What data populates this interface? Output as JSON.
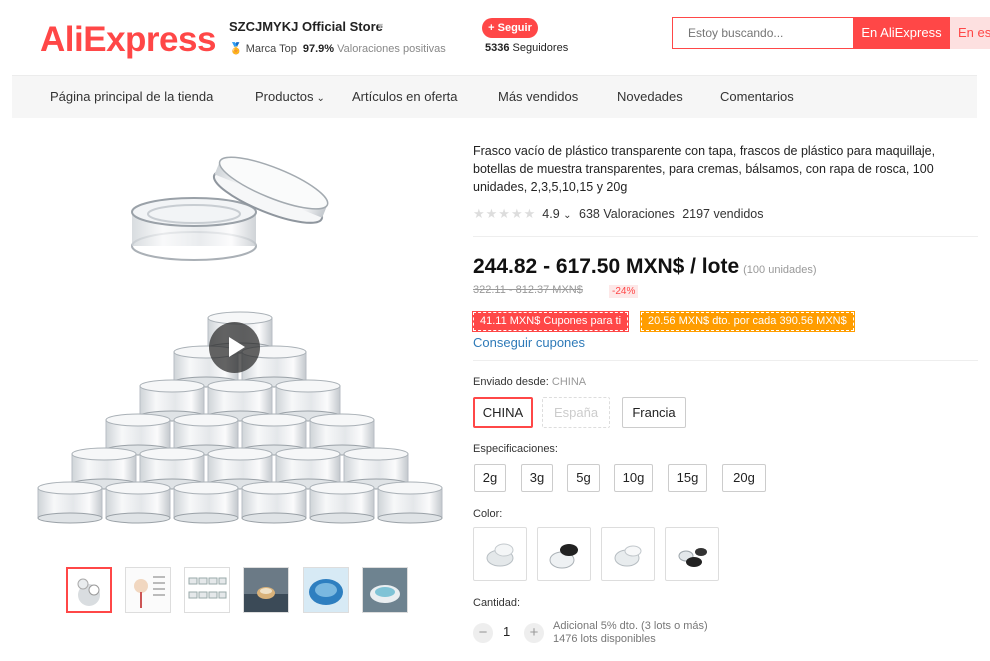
{
  "header": {
    "logo": "AliExpress",
    "store_name": "SZCJMYKJ Official Store",
    "store_badge": "Marca Top",
    "store_rating": "97.9%",
    "store_rating_label": "Valoraciones positivas",
    "follow_label": "+ Seguir",
    "followers_count": "5336",
    "followers_label": "Seguidores",
    "search_placeholder": "Estoy buscando...",
    "search_btn_aliexpress": "En AliExpress",
    "search_btn_store": "En esta tienda"
  },
  "nav": {
    "items": [
      "Página principal de la tienda",
      "Productos",
      "Artículos en oferta",
      "Más vendidos",
      "Novedades",
      "Comentarios"
    ]
  },
  "product": {
    "title": "Frasco vacío de plástico transparente con tapa, frascos de plástico para maquillaje, botellas de muestra transparentes, para cremas, bálsamos, con rapa de rosca, 100 unidades, 2,3,5,10,15 y 20g",
    "rating": "4.9",
    "rating_caret": "⌄",
    "reviews": "638 Valoraciones",
    "sold": "2197 vendidos",
    "rating_stars": 4.9,
    "price": "244.82 - 617.50 MXN$ / lote",
    "price_unit": "(100 unidades)",
    "original_price": "322.11 - 812.37 MXN$",
    "discount": "-24%",
    "coupon1": "41.11 MXN$ Cupones para ti",
    "coupon2": "20.56 MXN$ dto. por cada 390.56 MXN$",
    "get_coupons": "Conseguir cupones",
    "ships_from_label": "Enviado desde:",
    "ships_from_value": "CHINA",
    "ships_from_options": [
      "CHINA",
      "España",
      "Francia"
    ],
    "specs_label": "Especificaciones:",
    "specs_options": [
      "2g",
      "3g",
      "5g",
      "10g",
      "15g",
      "20g"
    ],
    "color_label": "Color:",
    "quantity_label": "Cantidad:",
    "quantity_value": "1",
    "quantity_minus": "−",
    "quantity_plus": "+",
    "quantity_note1": "Adicional 5% dto. (3 lots o más)",
    "quantity_note2": "1476 lots disponibles"
  },
  "icons": {
    "medal": "medal-icon",
    "play": "play-icon",
    "chevron": "chevron-down-icon"
  },
  "colors": {
    "brand": "#ff4747",
    "coupon_orange": "#ff9d00",
    "link": "#2e7ab8"
  }
}
